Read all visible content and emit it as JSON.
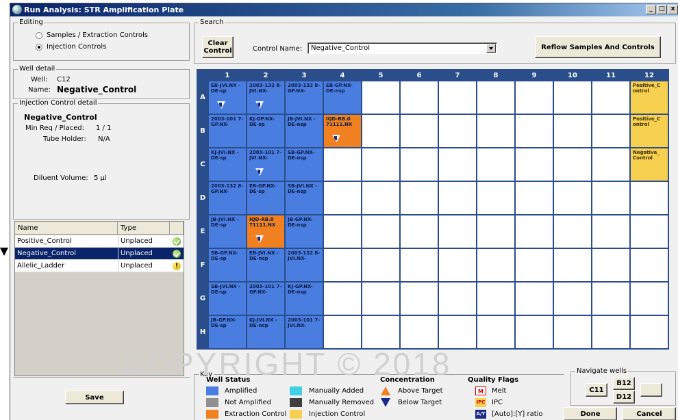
{
  "window": {
    "title": "Run Analysis: STR Amplification Plate",
    "controls": [
      "_",
      "□",
      "x"
    ]
  },
  "editing": {
    "label": "Editing",
    "options": [
      "Samples / Extraction Controls",
      "Injection Controls"
    ],
    "selected": 1
  },
  "search": {
    "label": "Search",
    "clear_label": "Clear Control",
    "control_name_label": "Control Name:",
    "control_name_value": "Negative_Control",
    "reflow_label": "Reflow Samples And Controls"
  },
  "well_detail": {
    "label": "Well detail",
    "well_label": "Well:",
    "well_value": "C12",
    "name_label": "Name:",
    "name_value": "Negative_Control"
  },
  "injection_detail": {
    "label": "Injection Control detail",
    "title": "Negative_Control",
    "min_req_label": "Min Req / Placed:",
    "min_req_value": "1  /  1",
    "tube_label": "Tube Holder:",
    "tube_value": "N/A",
    "diluent_label": "Diluent Volume:",
    "diluent_value": "5 µl"
  },
  "control_list": {
    "headers": [
      "Name",
      "Type"
    ],
    "rows": [
      {
        "name": "Positive_Control",
        "type": "Unplaced",
        "status": "ok"
      },
      {
        "name": "Negative_Control",
        "type": "Unplaced",
        "status": "ok",
        "selected": true
      },
      {
        "name": "Allelic_Ladder",
        "type": "Unplaced",
        "status": "warn",
        "status_text": "!"
      }
    ]
  },
  "save_label": "Save",
  "plate": {
    "columns": [
      "1",
      "2",
      "3",
      "4",
      "5",
      "6",
      "7",
      "8",
      "9",
      "10",
      "11",
      "12"
    ],
    "rows": [
      "A",
      "B",
      "C",
      "D",
      "E",
      "F",
      "G",
      "H"
    ],
    "wells": [
      {
        "row": 0,
        "col": 0,
        "text": "EB-JVI.NX -DE-sp",
        "type": "amp",
        "arrow": true
      },
      {
        "row": 0,
        "col": 1,
        "text": "2003-132 8-JVI.NX-",
        "type": "amp",
        "arrow": true
      },
      {
        "row": 0,
        "col": 2,
        "text": "2003-132 8-GP.NX-",
        "type": "amp"
      },
      {
        "row": 0,
        "col": 3,
        "text": "EB-GP.NX- DE-nsp",
        "type": "amp"
      },
      {
        "row": 0,
        "col": 11,
        "text": "Positive_C ontrol",
        "type": "inj"
      },
      {
        "row": 1,
        "col": 0,
        "text": "2003-101 7-GP.NX-",
        "type": "amp"
      },
      {
        "row": 1,
        "col": 1,
        "text": "KJ-GP.NX- DE-sp",
        "type": "amp"
      },
      {
        "row": 1,
        "col": 2,
        "text": "JB-JVI.NX -DE-nsp",
        "type": "amp"
      },
      {
        "row": 1,
        "col": 3,
        "text": "IQD-RB.0 71111.NX",
        "type": "ext",
        "arrow": true
      },
      {
        "row": 1,
        "col": 11,
        "text": "Positive_C ontrol",
        "type": "inj"
      },
      {
        "row": 2,
        "col": 0,
        "text": "KJ-JVI.NX -DE-sp",
        "type": "amp"
      },
      {
        "row": 2,
        "col": 1,
        "text": "2003-101 7-JVI.NX-",
        "type": "amp",
        "arrow": true
      },
      {
        "row": 2,
        "col": 2,
        "text": "SB-GP.NX- DE-nsp",
        "type": "amp"
      },
      {
        "row": 2,
        "col": 11,
        "text": "Negative_ Control",
        "type": "inj"
      },
      {
        "row": 3,
        "col": 0,
        "text": "2003-132 8-GP.NX-",
        "type": "amp"
      },
      {
        "row": 3,
        "col": 1,
        "text": "EB-GP.NX- DE-sp",
        "type": "amp"
      },
      {
        "row": 3,
        "col": 2,
        "text": "SB-JVI.NX -DE-nsp",
        "type": "amp"
      },
      {
        "row": 4,
        "col": 0,
        "text": "JB-JVI.NX -DE-sp",
        "type": "amp"
      },
      {
        "row": 4,
        "col": 1,
        "text": "IQD-RB.0 71111.NX",
        "type": "ext",
        "arrow": true
      },
      {
        "row": 4,
        "col": 2,
        "text": "JB-GP.NX- DE-nsp",
        "type": "amp"
      },
      {
        "row": 5,
        "col": 0,
        "text": "SB-GP.NX- DE-sp",
        "type": "amp"
      },
      {
        "row": 5,
        "col": 1,
        "text": "EB-JVI.NX -DE-nsp",
        "type": "amp"
      },
      {
        "row": 5,
        "col": 2,
        "text": "2003-132 8-JVI.NX-",
        "type": "amp"
      },
      {
        "row": 6,
        "col": 0,
        "text": "SB-JVI.NX -DE-sp",
        "type": "amp"
      },
      {
        "row": 6,
        "col": 1,
        "text": "2003-101 7-GP.NX-",
        "type": "amp"
      },
      {
        "row": 6,
        "col": 2,
        "text": "KJ-GP.NX- DE-nsp",
        "type": "amp"
      },
      {
        "row": 7,
        "col": 0,
        "text": "JB-GP.NX- DE-sp",
        "type": "amp"
      },
      {
        "row": 7,
        "col": 1,
        "text": "KJ-JVI.NX -DE-nsp",
        "type": "amp"
      },
      {
        "row": 7,
        "col": 2,
        "text": "2003-101 7-JVI.NX-",
        "type": "amp"
      }
    ]
  },
  "key": {
    "label": "Key",
    "well_status_title": "Well Status",
    "well_status": [
      {
        "label": "Amplified",
        "color": "#4a7de0"
      },
      {
        "label": "Not Amplified",
        "color": "#909090"
      },
      {
        "label": "Extraction Control",
        "color": "#f08020"
      },
      {
        "label": "Manually Added",
        "color": "#40d0e8"
      },
      {
        "label": "Manually Removed",
        "color": "#404040"
      },
      {
        "label": "Injection Control",
        "color": "#f8d050"
      }
    ],
    "concentration_title": "Concentration",
    "concentration": [
      "Above Target",
      "Below Target"
    ],
    "quality_title": "Quality Flags",
    "quality": [
      {
        "flag": "M",
        "label": "Melt"
      },
      {
        "flag": "IPC",
        "label": "IPC"
      },
      {
        "flag": "A/Y",
        "label": "[Auto]:[Y] ratio"
      }
    ]
  },
  "watermark": "COPYRIGHT © 2018",
  "navigate": {
    "label": "Navigate wells",
    "buttons": [
      "C11",
      "B12",
      "D12",
      ""
    ]
  },
  "done_label": "Done",
  "cancel_label": "Cancel"
}
